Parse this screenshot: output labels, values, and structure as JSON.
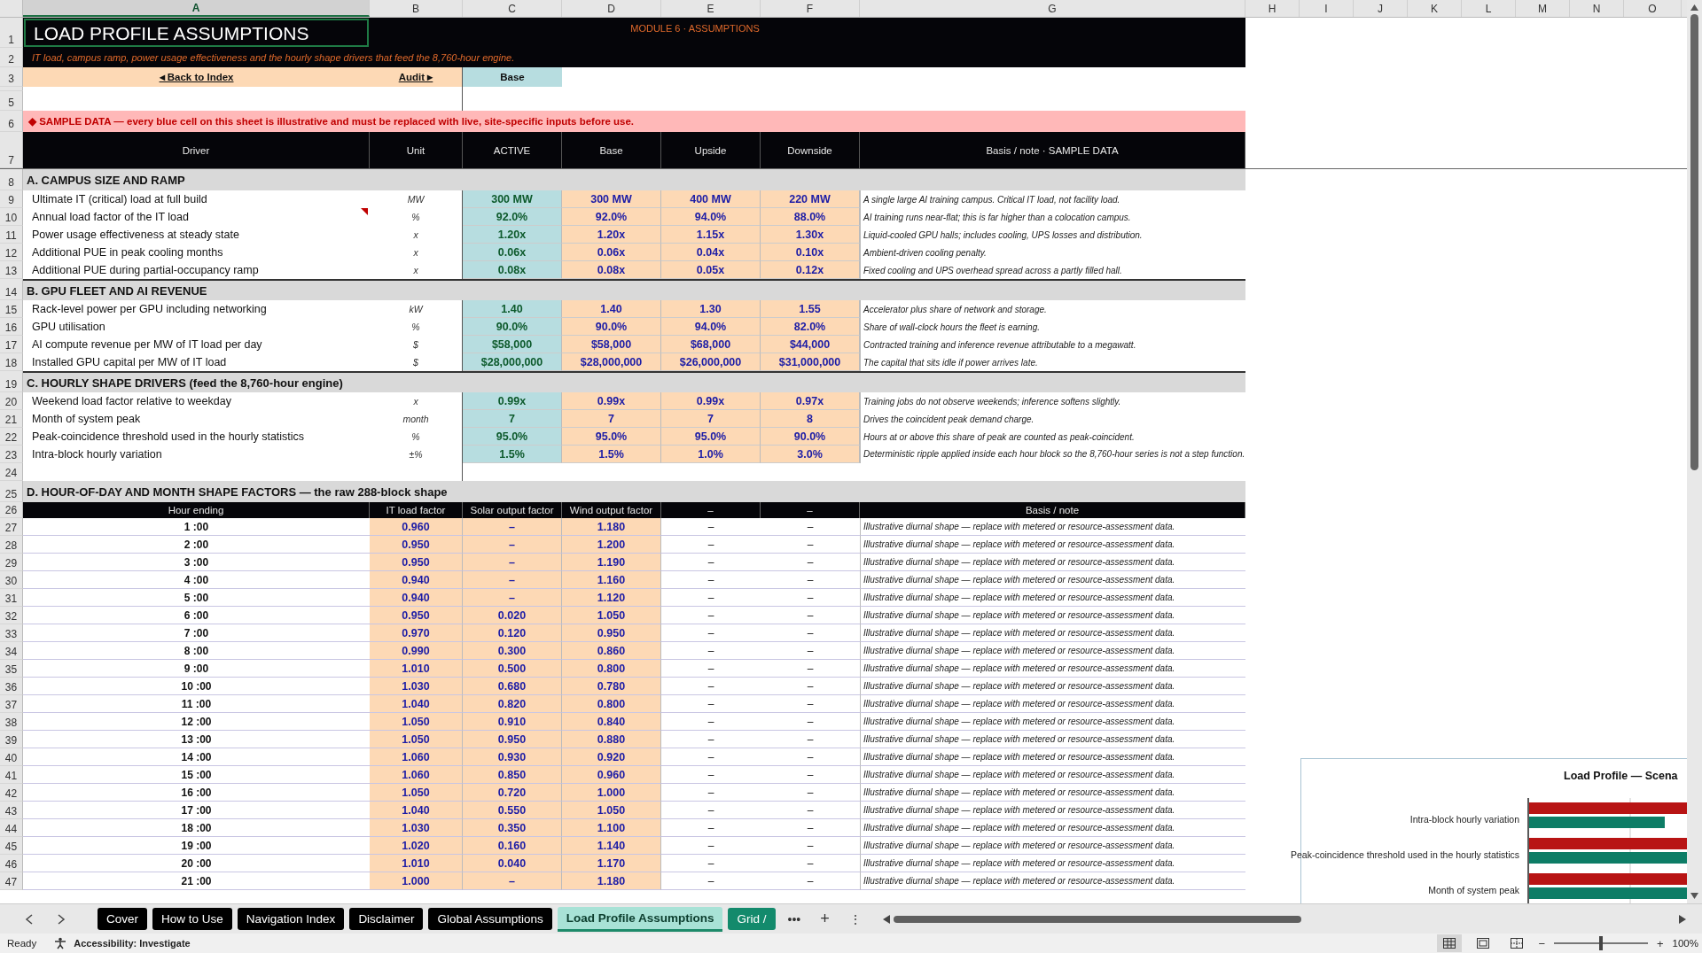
{
  "columns": [
    {
      "label": "A",
      "selected": true
    },
    {
      "label": "B",
      "selected": false
    },
    {
      "label": "C",
      "selected": false
    },
    {
      "label": "D",
      "selected": false
    },
    {
      "label": "E",
      "selected": false
    },
    {
      "label": "F",
      "selected": false
    },
    {
      "label": "G",
      "selected": false
    },
    {
      "label": "H",
      "selected": false
    },
    {
      "label": "I",
      "selected": false
    },
    {
      "label": "J",
      "selected": false
    },
    {
      "label": "K",
      "selected": false
    },
    {
      "label": "L",
      "selected": false
    },
    {
      "label": "M",
      "selected": false
    },
    {
      "label": "N",
      "selected": false
    },
    {
      "label": "O",
      "selected": false
    }
  ],
  "row_numbers": [
    "1",
    "2",
    "3",
    "5",
    "6",
    "7",
    "8",
    "9",
    "10",
    "11",
    "12",
    "13",
    "14",
    "15",
    "16",
    "17",
    "18",
    "19",
    "20",
    "21",
    "22",
    "23",
    "24",
    "25",
    "26",
    "27",
    "28",
    "29",
    "30",
    "31",
    "32",
    "33",
    "34",
    "35",
    "36",
    "37",
    "38",
    "39",
    "40",
    "41",
    "42",
    "43",
    "44",
    "45",
    "46",
    "47"
  ],
  "title": "LOAD PROFILE ASSUMPTIONS",
  "module_label": "MODULE 6  ·  ASSUMPTIONS",
  "subtitle": "IT load, campus ramp, power usage effectiveness and the hourly shape drivers that feed the 8,760-hour engine.",
  "nav": {
    "back": "◂  Back to Index",
    "audit": "Audit ▸",
    "scenario": "Base"
  },
  "banner": "◆  SAMPLE DATA — every blue cell on this sheet is illustrative and must be replaced with live, site-specific inputs before use.",
  "header": {
    "driver": "Driver",
    "unit": "Unit",
    "scenarios": [
      "ACTIVE",
      "Base",
      "Upside",
      "Downside"
    ],
    "note": "Basis / note  ·  SAMPLE DATA"
  },
  "sections": [
    {
      "title": "A.  CAMPUS SIZE AND RAMP",
      "rows": [
        {
          "label": "Ultimate IT (critical) load at full build",
          "unit": "MW",
          "values": [
            "300 MW",
            "300 MW",
            "400 MW",
            "220 MW"
          ],
          "note": "A single large AI training campus. Critical IT load, not facility load.",
          "comment": false
        },
        {
          "label": "Annual load factor of the IT load",
          "unit": "%",
          "values": [
            "92.0%",
            "92.0%",
            "94.0%",
            "88.0%"
          ],
          "note": "AI training runs near-flat; this is far higher than a colocation campus.",
          "comment": true
        },
        {
          "label": "Power usage effectiveness at steady state",
          "unit": "x",
          "values": [
            "1.20x",
            "1.20x",
            "1.15x",
            "1.30x"
          ],
          "note": "Liquid-cooled GPU halls; includes cooling, UPS losses and distribution.",
          "comment": false
        },
        {
          "label": "Additional PUE in peak cooling months",
          "unit": "x",
          "values": [
            "0.06x",
            "0.06x",
            "0.04x",
            "0.10x"
          ],
          "note": "Ambient-driven cooling penalty.",
          "comment": false
        },
        {
          "label": "Additional PUE during partial-occupancy ramp",
          "unit": "x",
          "values": [
            "0.08x",
            "0.08x",
            "0.05x",
            "0.12x"
          ],
          "note": "Fixed cooling and UPS overhead spread across a partly filled hall.",
          "comment": false
        }
      ]
    },
    {
      "title": "B.  GPU FLEET AND AI REVENUE",
      "rows": [
        {
          "label": "Rack-level power per GPU including networking",
          "unit": "kW",
          "values": [
            "1.40",
            "1.40",
            "1.30",
            "1.55"
          ],
          "note": "Accelerator plus share of network and storage.",
          "comment": false
        },
        {
          "label": "GPU utilisation",
          "unit": "%",
          "values": [
            "90.0%",
            "90.0%",
            "94.0%",
            "82.0%"
          ],
          "note": "Share of wall-clock hours the fleet is earning.",
          "comment": false
        },
        {
          "label": "AI compute revenue per MW of IT load per day",
          "unit": "$",
          "values": [
            "$58,000",
            "$58,000",
            "$68,000",
            "$44,000"
          ],
          "note": "Contracted training and inference revenue attributable to a megawatt.",
          "comment": false
        },
        {
          "label": "Installed GPU capital per MW of IT load",
          "unit": "$",
          "values": [
            "$28,000,000",
            "$28,000,000",
            "$26,000,000",
            "$31,000,000"
          ],
          "note": "The capital that sits idle if power arrives late.",
          "comment": false
        }
      ]
    },
    {
      "title": "C.  HOURLY SHAPE DRIVERS  (feed the 8,760-hour engine)",
      "rows": [
        {
          "label": "Weekend load factor relative to weekday",
          "unit": "x",
          "values": [
            "0.99x",
            "0.99x",
            "0.99x",
            "0.97x"
          ],
          "note": "Training jobs do not observe weekends; inference softens slightly.",
          "comment": false
        },
        {
          "label": "Month of system peak",
          "unit": "month",
          "values": [
            "7",
            "7",
            "7",
            "8"
          ],
          "note": "Drives the coincident peak demand charge.",
          "comment": false
        },
        {
          "label": "Peak-coincidence threshold used in the hourly statistics",
          "unit": "%",
          "values": [
            "95.0%",
            "95.0%",
            "95.0%",
            "90.0%"
          ],
          "note": "Hours at or above this share of peak are counted as peak-coincident.",
          "comment": false
        },
        {
          "label": "Intra-block hourly variation",
          "unit": "±%",
          "values": [
            "1.5%",
            "1.5%",
            "1.0%",
            "3.0%"
          ],
          "note": "Deterministic ripple applied inside each hour block so the 8,760-hour series is not a step function.",
          "comment": false
        }
      ]
    }
  ],
  "shape": {
    "title": "D.  HOUR-OF-DAY AND MONTH SHAPE FACTORS  —  the raw 288-block shape",
    "columns": [
      "Hour ending",
      "IT load factor",
      "Solar output factor",
      "Wind output factor",
      "–",
      "–",
      "Basis / note"
    ],
    "rows": [
      {
        "hour": "1 :00",
        "it": "0.960",
        "solar": "–",
        "wind": "1.180",
        "column_5": "–",
        "column_6": "–",
        "note": "Illustrative diurnal shape — replace with metered or resource-assessment data."
      },
      {
        "hour": "2 :00",
        "it": "0.950",
        "solar": "–",
        "wind": "1.200",
        "column_5": "–",
        "column_6": "–",
        "note": "Illustrative diurnal shape — replace with metered or resource-assessment data."
      },
      {
        "hour": "3 :00",
        "it": "0.950",
        "solar": "–",
        "wind": "1.190",
        "column_5": "–",
        "column_6": "–",
        "note": "Illustrative diurnal shape — replace with metered or resource-assessment data."
      },
      {
        "hour": "4 :00",
        "it": "0.940",
        "solar": "–",
        "wind": "1.160",
        "column_5": "–",
        "column_6": "–",
        "note": "Illustrative diurnal shape — replace with metered or resource-assessment data."
      },
      {
        "hour": "5 :00",
        "it": "0.940",
        "solar": "–",
        "wind": "1.120",
        "column_5": "–",
        "column_6": "–",
        "note": "Illustrative diurnal shape — replace with metered or resource-assessment data."
      },
      {
        "hour": "6 :00",
        "it": "0.950",
        "solar": "0.020",
        "wind": "1.050",
        "column_5": "–",
        "column_6": "–",
        "note": "Illustrative diurnal shape — replace with metered or resource-assessment data."
      },
      {
        "hour": "7 :00",
        "it": "0.970",
        "solar": "0.120",
        "wind": "0.950",
        "column_5": "–",
        "column_6": "–",
        "note": "Illustrative diurnal shape — replace with metered or resource-assessment data."
      },
      {
        "hour": "8 :00",
        "it": "0.990",
        "solar": "0.300",
        "wind": "0.860",
        "column_5": "–",
        "column_6": "–",
        "note": "Illustrative diurnal shape — replace with metered or resource-assessment data."
      },
      {
        "hour": "9 :00",
        "it": "1.010",
        "solar": "0.500",
        "wind": "0.800",
        "column_5": "–",
        "column_6": "–",
        "note": "Illustrative diurnal shape — replace with metered or resource-assessment data."
      },
      {
        "hour": "10 :00",
        "it": "1.030",
        "solar": "0.680",
        "wind": "0.780",
        "column_5": "–",
        "column_6": "–",
        "note": "Illustrative diurnal shape — replace with metered or resource-assessment data."
      },
      {
        "hour": "11 :00",
        "it": "1.040",
        "solar": "0.820",
        "wind": "0.800",
        "column_5": "–",
        "column_6": "–",
        "note": "Illustrative diurnal shape — replace with metered or resource-assessment data."
      },
      {
        "hour": "12 :00",
        "it": "1.050",
        "solar": "0.910",
        "wind": "0.840",
        "column_5": "–",
        "column_6": "–",
        "note": "Illustrative diurnal shape — replace with metered or resource-assessment data."
      },
      {
        "hour": "13 :00",
        "it": "1.050",
        "solar": "0.950",
        "wind": "0.880",
        "column_5": "–",
        "column_6": "–",
        "note": "Illustrative diurnal shape — replace with metered or resource-assessment data."
      },
      {
        "hour": "14 :00",
        "it": "1.060",
        "solar": "0.930",
        "wind": "0.920",
        "column_5": "–",
        "column_6": "–",
        "note": "Illustrative diurnal shape — replace with metered or resource-assessment data."
      },
      {
        "hour": "15 :00",
        "it": "1.060",
        "solar": "0.850",
        "wind": "0.960",
        "column_5": "–",
        "column_6": "–",
        "note": "Illustrative diurnal shape — replace with metered or resource-assessment data."
      },
      {
        "hour": "16 :00",
        "it": "1.050",
        "solar": "0.720",
        "wind": "1.000",
        "column_5": "–",
        "column_6": "–",
        "note": "Illustrative diurnal shape — replace with metered or resource-assessment data."
      },
      {
        "hour": "17 :00",
        "it": "1.040",
        "solar": "0.550",
        "wind": "1.050",
        "column_5": "–",
        "column_6": "–",
        "note": "Illustrative diurnal shape — replace with metered or resource-assessment data."
      },
      {
        "hour": "18 :00",
        "it": "1.030",
        "solar": "0.350",
        "wind": "1.100",
        "column_5": "–",
        "column_6": "–",
        "note": "Illustrative diurnal shape — replace with metered or resource-assessment data."
      },
      {
        "hour": "19 :00",
        "it": "1.020",
        "solar": "0.160",
        "wind": "1.140",
        "column_5": "–",
        "column_6": "–",
        "note": "Illustrative diurnal shape — replace with metered or resource-assessment data."
      },
      {
        "hour": "20 :00",
        "it": "1.010",
        "solar": "0.040",
        "wind": "1.170",
        "column_5": "–",
        "column_6": "–",
        "note": "Illustrative diurnal shape — replace with metered or resource-assessment data."
      },
      {
        "hour": "21 :00",
        "it": "1.000",
        "solar": "–",
        "wind": "1.180",
        "column_5": "–",
        "column_6": "–",
        "note": "Illustrative diurnal shape — replace with metered or resource-assessment data."
      }
    ]
  },
  "chart": {
    "title": "Load Profile — Scena",
    "categories": [
      "Intra-block hourly variation",
      "Peak-coincidence threshold used in the hourly statistics",
      "Month of system peak"
    ]
  },
  "sheet_tabs": [
    {
      "label": "Cover",
      "selected": false,
      "color": "#000000"
    },
    {
      "label": "How to Use",
      "selected": false,
      "color": "#000000"
    },
    {
      "label": "Navigation Index",
      "selected": false,
      "color": "#000000"
    },
    {
      "label": "Disclaimer",
      "selected": false,
      "color": "#000000"
    },
    {
      "label": "Global Assumptions",
      "selected": false,
      "color": "#000000"
    },
    {
      "label": "Load Profile Assumptions",
      "selected": true,
      "color": "#a8e2d6"
    },
    {
      "label": "Grid /",
      "selected": false,
      "color": "#138a6c"
    }
  ],
  "tab_more": "•••",
  "tab_add": "+",
  "tab_menu": "⋮",
  "status": {
    "ready": "Ready",
    "accessibility": "Accessibility: Investigate",
    "views": [
      {
        "selected": true
      },
      {
        "selected": false
      },
      {
        "selected": false
      }
    ],
    "zoom_minus": "−",
    "zoom_plus": "+",
    "zoom": {
      "level": 0.5
    },
    "zoom_text": "100%"
  }
}
